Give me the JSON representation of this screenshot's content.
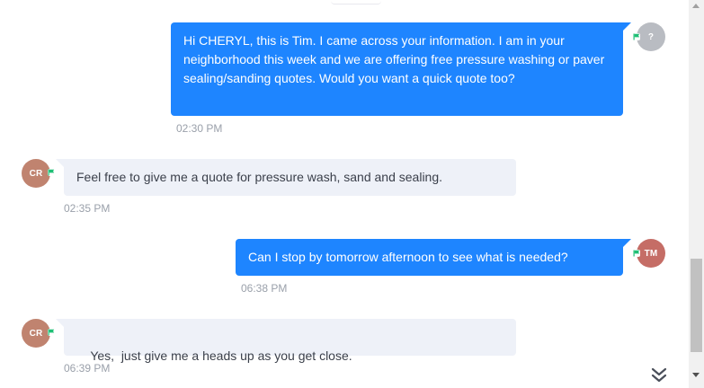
{
  "messages": [
    {
      "direction": "outgoing",
      "avatar_initials": "?",
      "text": "Hi CHERYL, this is Tim. I came across your information. I am in your neighborhood this week and we are offering free pressure washing or paver sealing/sanding quotes. Would you want a quick quote too?",
      "time": "02:30 PM"
    },
    {
      "direction": "incoming",
      "avatar_initials": "CR",
      "text": "Feel free to give me a quote for pressure wash, sand and sealing.",
      "time": "02:35 PM"
    },
    {
      "direction": "outgoing",
      "avatar_initials": "TM",
      "text": "Can I stop by tomorrow afternoon to see what is needed?",
      "time": "06:38 PM"
    },
    {
      "direction": "incoming",
      "avatar_initials": "CR",
      "text": "Yes,  just give me a heads up as you get close.",
      "time": "06:39 PM"
    }
  ],
  "icons": {
    "channel": "sms-flag-icon",
    "jump": "double-chevron-down-icon"
  },
  "colors": {
    "outgoing_bubble": "#1e85ff",
    "incoming_bubble": "#eef1f8",
    "channel_flag": "#1fbf75",
    "timestamp": "#9aa0aa"
  }
}
